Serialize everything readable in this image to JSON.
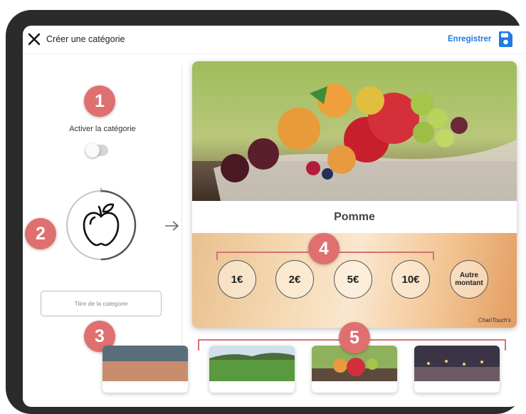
{
  "topbar": {
    "title": "Créer une catégorie",
    "save_label": "Enregistrer",
    "close_icon": "close-icon",
    "save_icon": "floppy-disk-icon"
  },
  "callouts": [
    "1",
    "2",
    "3",
    "4",
    "5"
  ],
  "left_panel": {
    "activate_label": "Activer la catégorie",
    "toggle_on": false,
    "category_icon": "apple-icon",
    "title_placeholder": "Titre de la categorie"
  },
  "preview": {
    "category_name": "Pomme",
    "amounts": [
      "1€",
      "2€",
      "5€",
      "10€"
    ],
    "other_amount_line1": "Autre",
    "other_amount_line2": "montant",
    "watermark": "ChariTouch's"
  },
  "thumbnails": [
    {
      "name": "partial-coastal-image"
    },
    {
      "name": "green-field-image"
    },
    {
      "name": "fruit-table-image"
    },
    {
      "name": "candles-image"
    }
  ],
  "colors": {
    "accent": "#1f7ae0",
    "callout": "#e06f6f",
    "frame": "#2b2b2b"
  }
}
